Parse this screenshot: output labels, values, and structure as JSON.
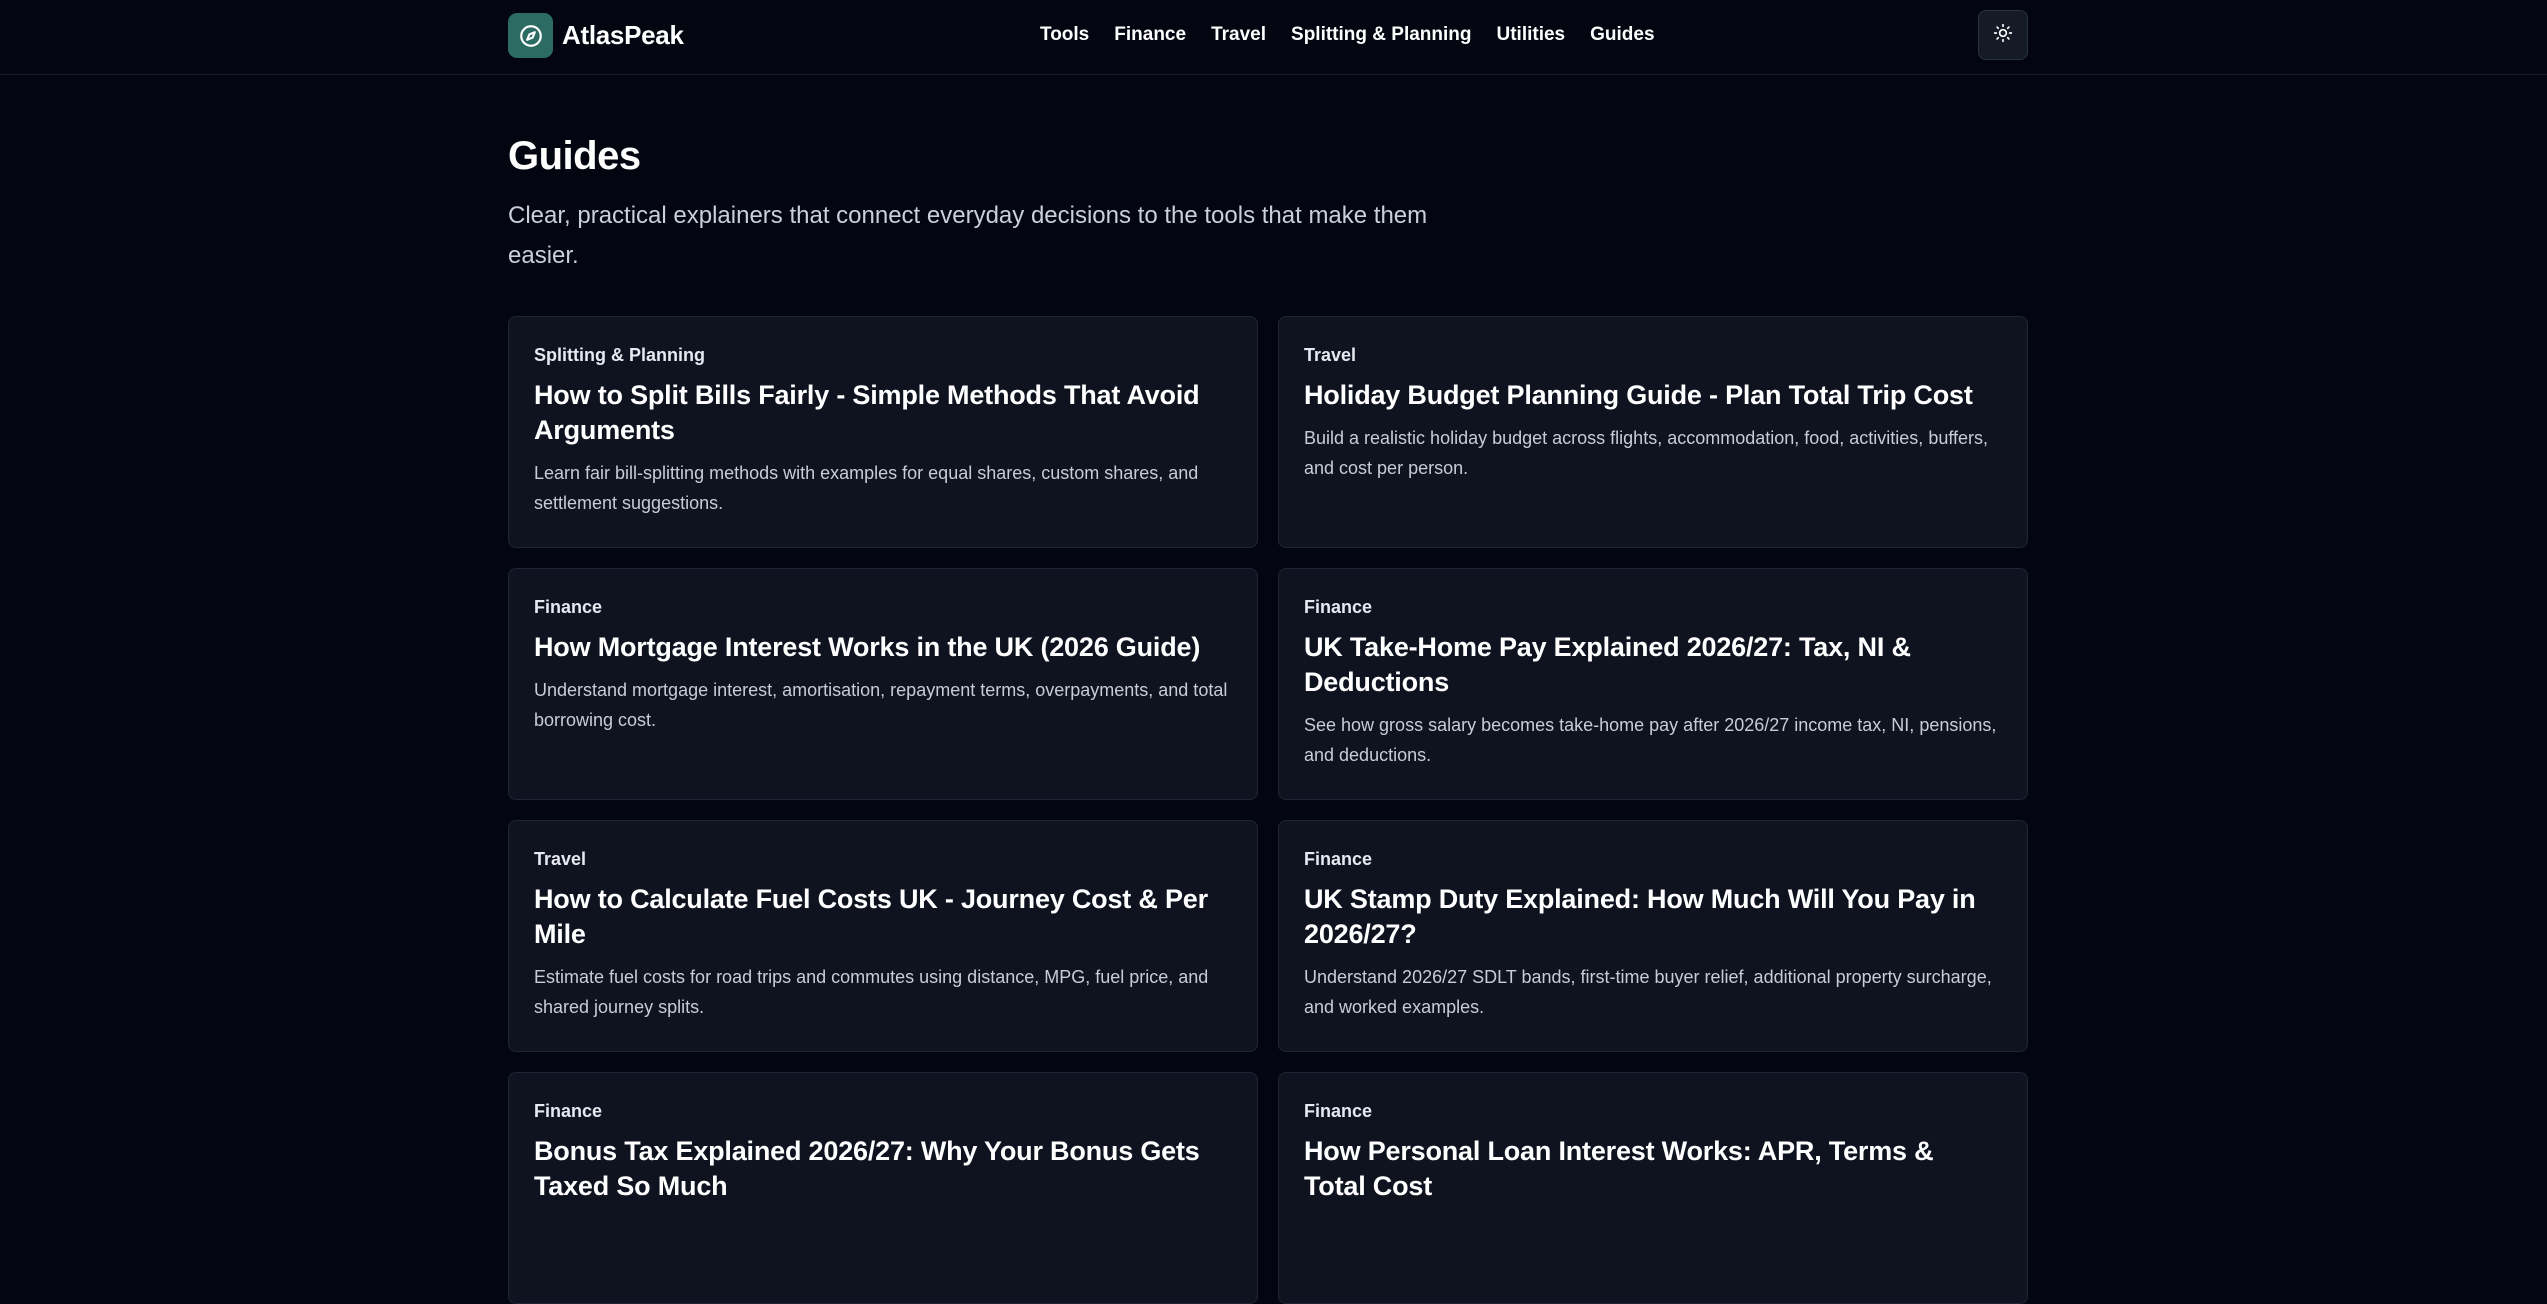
{
  "header": {
    "brand_name": "AtlasPeak",
    "brand_icon": "compass-icon",
    "nav": [
      "Tools",
      "Finance",
      "Travel",
      "Splitting & Planning",
      "Utilities",
      "Guides"
    ],
    "theme_icon": "sun-icon",
    "accent_color": "#2b6b62"
  },
  "page": {
    "title": "Guides",
    "description": "Clear, practical explainers that connect everyday decisions to the tools that make them easier."
  },
  "guides": [
    {
      "category": "Splitting & Planning",
      "title": "How to Split Bills Fairly - Simple Methods That Avoid Arguments",
      "description": "Learn fair bill-splitting methods with examples for equal shares, custom shares, and settlement suggestions."
    },
    {
      "category": "Travel",
      "title": "Holiday Budget Planning Guide - Plan Total Trip Cost",
      "description": "Build a realistic holiday budget across flights, accommodation, food, activities, buffers, and cost per person."
    },
    {
      "category": "Finance",
      "title": "How Mortgage Interest Works in the UK (2026 Guide)",
      "description": "Understand mortgage interest, amortisation, repayment terms, overpayments, and total borrowing cost."
    },
    {
      "category": "Finance",
      "title": "UK Take-Home Pay Explained 2026/27: Tax, NI & Deductions",
      "description": "See how gross salary becomes take-home pay after 2026/27 income tax, NI, pensions, and deductions."
    },
    {
      "category": "Travel",
      "title": "How to Calculate Fuel Costs UK - Journey Cost & Per Mile",
      "description": "Estimate fuel costs for road trips and commutes using distance, MPG, fuel price, and shared journey splits."
    },
    {
      "category": "Finance",
      "title": "UK Stamp Duty Explained: How Much Will You Pay in 2026/27?",
      "description": "Understand 2026/27 SDLT bands, first-time buyer relief, additional property surcharge, and worked examples."
    },
    {
      "category": "Finance",
      "title": "Bonus Tax Explained 2026/27: Why Your Bonus Gets Taxed So Much",
      "description": ""
    },
    {
      "category": "Finance",
      "title": "How Personal Loan Interest Works: APR, Terms & Total Cost",
      "description": ""
    }
  ]
}
